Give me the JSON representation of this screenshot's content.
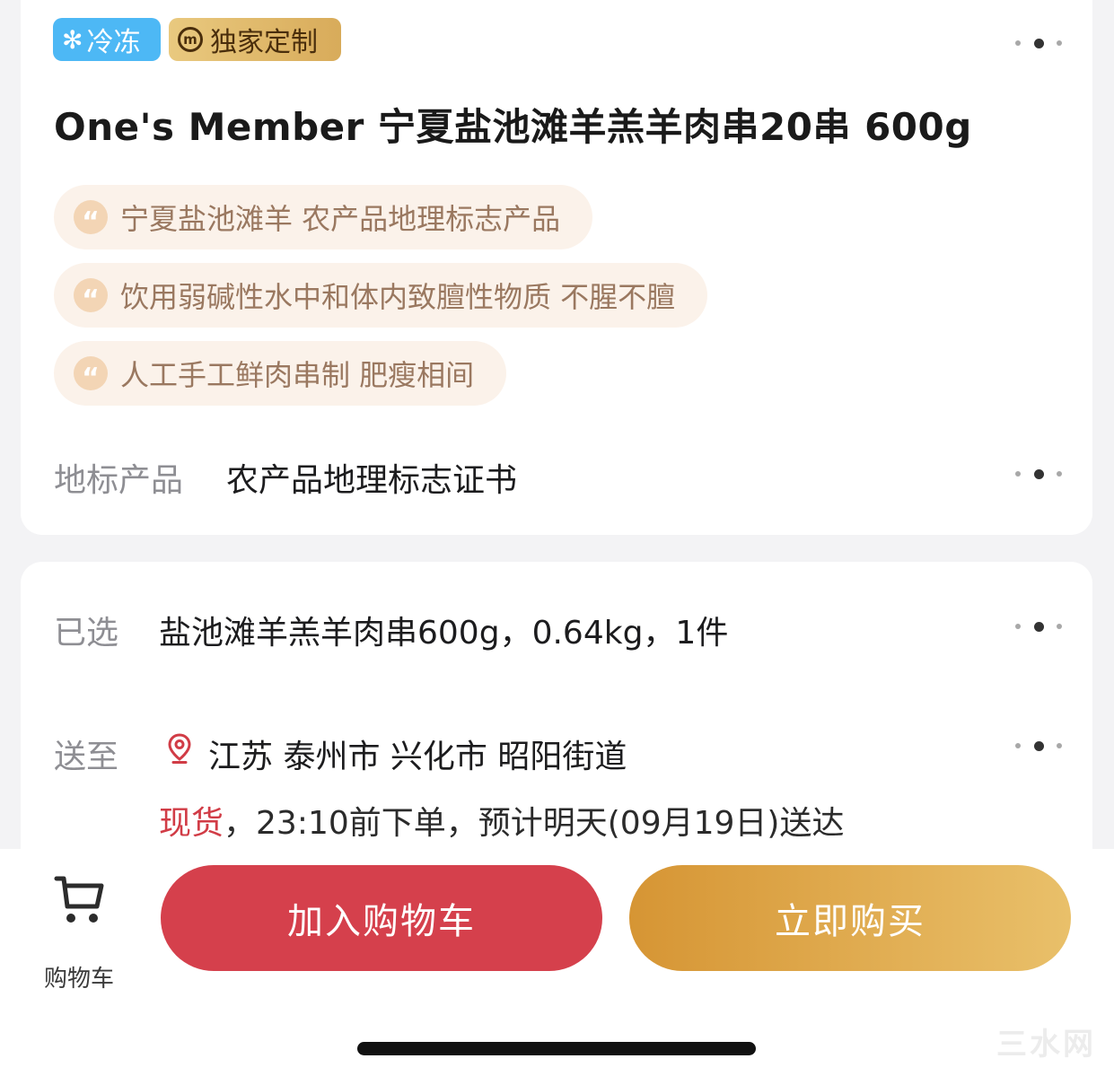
{
  "badges": {
    "frozen_icon": "✻",
    "frozen": "冷冻",
    "custom_icon": "m",
    "custom": "独家定制"
  },
  "product": {
    "title": "One's Member 宁夏盐池滩羊羔羊肉串20串  600g",
    "quote_icon": "“",
    "features": [
      "宁夏盐池滩羊 农产品地理标志产品",
      "饮用弱碱性水中和体内致膻性物质 不腥不膻",
      "人工手工鲜肉串制 肥瘦相间"
    ],
    "geo_label": "地标产品",
    "geo_value": "农产品地理标志证书"
  },
  "order": {
    "selected_label": "已选",
    "selected_value": "盐池滩羊羔羊肉串600g，0.64kg，1件",
    "ship_label": "送至",
    "address": "江苏  泰州市  兴化市  昭阳街道",
    "stock_status": "现货",
    "delivery_text": "，23:10前下单，预计明天(09月19日)送达"
  },
  "bottom_bar": {
    "cart_label": "购物车",
    "add_to_cart": "加入购物车",
    "buy_now": "立即购买"
  },
  "watermark": "三水网",
  "colors": {
    "frozen_badge": "#4db8f5",
    "add_to_cart": "#d5404c",
    "buy_now_start": "#d69534",
    "buy_now_end": "#e9c06a",
    "stock_red": "#d13c46"
  }
}
